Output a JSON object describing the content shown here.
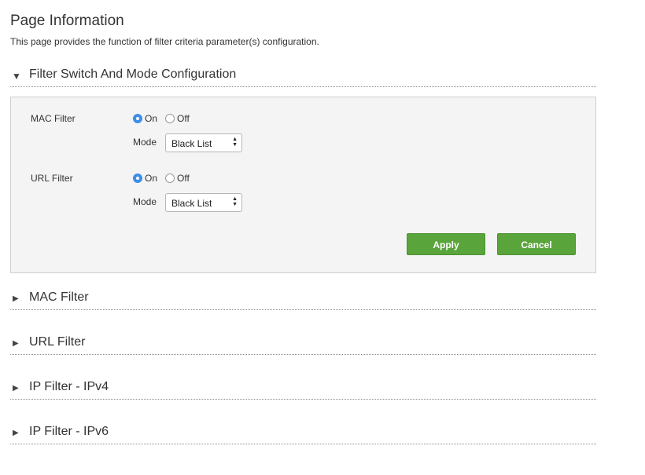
{
  "page": {
    "title": "Page Information",
    "description": "This page provides the function of filter criteria parameter(s) configuration."
  },
  "sections": {
    "filter_switch": {
      "label": "Filter Switch And Mode Configuration",
      "expanded": true
    },
    "mac_filter": {
      "label": "MAC Filter",
      "expanded": false
    },
    "url_filter": {
      "label": "URL Filter",
      "expanded": false
    },
    "ip_filter_v4": {
      "label": "IP Filter - IPv4",
      "expanded": false
    },
    "ip_filter_v6": {
      "label": "IP Filter - IPv6",
      "expanded": false
    }
  },
  "form": {
    "mac": {
      "label": "MAC Filter",
      "on_label": "On",
      "off_label": "Off",
      "selected": "On",
      "mode_label": "Mode",
      "mode_value": "Black List"
    },
    "url": {
      "label": "URL Filter",
      "on_label": "On",
      "off_label": "Off",
      "selected": "On",
      "mode_label": "Mode",
      "mode_value": "Black List"
    },
    "apply_label": "Apply",
    "cancel_label": "Cancel"
  },
  "colors": {
    "accent_radio": "#3d8ee8",
    "button_green": "#5aa43c",
    "panel_bg": "#f4f4f4"
  },
  "icons": {
    "expanded": "triangle-down-icon",
    "collapsed": "triangle-right-icon",
    "select": "up-down-arrows-icon"
  }
}
